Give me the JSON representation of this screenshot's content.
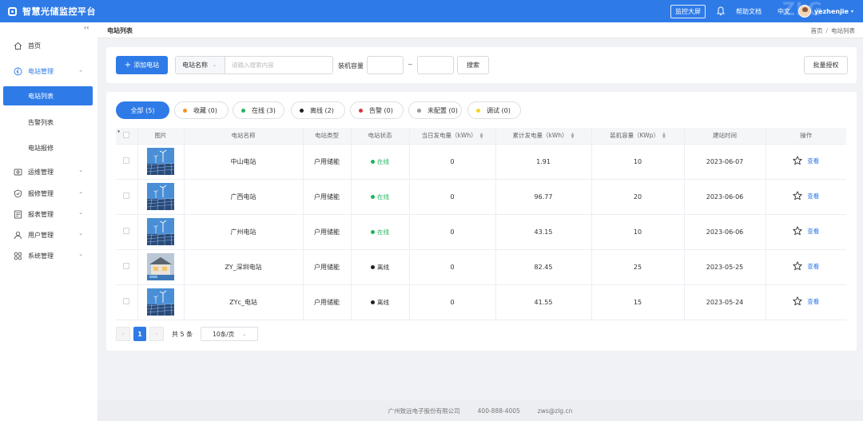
{
  "header": {
    "app_title": "智慧光储监控平台",
    "monitor_button": "监控大屏",
    "help": "帮助文档",
    "language": "中文",
    "watermark": "ZLG",
    "username": "yezhenjie",
    "user_caret": "▾",
    "colors": {
      "header_bg": "#2e7be8"
    }
  },
  "sidebar": {
    "collapse_glyph": "‹‹",
    "items": [
      {
        "label": "首页",
        "icon": "home-icon"
      },
      {
        "label": "电站管理",
        "icon": "plant-icon",
        "expanded": true
      },
      {
        "label": "运维管理",
        "icon": "maintenance-icon"
      },
      {
        "label": "报修管理",
        "icon": "repair-icon"
      },
      {
        "label": "报表管理",
        "icon": "report-icon"
      },
      {
        "label": "用户管理",
        "icon": "user-icon"
      },
      {
        "label": "系统管理",
        "icon": "system-icon"
      }
    ],
    "submenu": [
      {
        "label": "电站列表",
        "active": true
      },
      {
        "label": "告警列表"
      },
      {
        "label": "电站报修"
      }
    ],
    "arrow_down": "⌄",
    "arrow_up": "⌃"
  },
  "breadcrumb": {
    "page_title": "电站列表",
    "path": [
      "首页",
      "电站列表"
    ],
    "separator": "/"
  },
  "filter": {
    "add_button": "添加电站",
    "add_plus": "+",
    "search_field_select": "电站名称",
    "search_placeholder": "请输入搜索内容",
    "capacity_label": "装机容量",
    "range_separator": "~",
    "search_button": "搜索",
    "batch_button": "批量授权"
  },
  "status_tabs": [
    {
      "label": "全部 (5)",
      "active": true
    },
    {
      "label": "收藏 (0)",
      "dot_color": "#f7941d"
    },
    {
      "label": "在线 (3)",
      "dot_color": "#22b35e"
    },
    {
      "label": "离线 (2)",
      "dot_color": "#222222"
    },
    {
      "label": "告警 (0)",
      "dot_color": "#d9363e"
    },
    {
      "label": "未配置 (0)",
      "dot_color": "#999999"
    },
    {
      "label": "调试 (0)",
      "dot_color": "#f5d524"
    }
  ],
  "table": {
    "columns": [
      "图片",
      "电站名称",
      "电站类型",
      "电站状态",
      "当日发电量（kWh）",
      "累计发电量（kWh）",
      "装机容量（KWp）",
      "建站时间",
      "操作"
    ],
    "rows": [
      {
        "image": "solar-wind-photo",
        "name": "中山电站",
        "type": "户用储能",
        "status": "在线",
        "status_kind": "online",
        "daily": "0",
        "total": "1.91",
        "capacity": "10",
        "date": "2023-06-07",
        "action": "查看"
      },
      {
        "image": "solar-wind-photo",
        "name": "广西电站",
        "type": "户用储能",
        "status": "在线",
        "status_kind": "online",
        "daily": "0",
        "total": "96.77",
        "capacity": "20",
        "date": "2023-06-06",
        "action": "查看"
      },
      {
        "image": "solar-wind-photo",
        "name": "广州电站",
        "type": "户用储能",
        "status": "在线",
        "status_kind": "online",
        "daily": "0",
        "total": "43.15",
        "capacity": "10",
        "date": "2023-06-06",
        "action": "查看"
      },
      {
        "image": "house-photo",
        "name": "ZY_深圳电站",
        "type": "户用储能",
        "status": "离线",
        "status_kind": "offline",
        "daily": "0",
        "total": "82.45",
        "capacity": "25",
        "date": "2023-05-25",
        "action": "查看"
      },
      {
        "image": "solar-wind-photo",
        "name": "ZYc_电站",
        "type": "户用储能",
        "status": "离线",
        "status_kind": "offline",
        "daily": "0",
        "total": "41.55",
        "capacity": "15",
        "date": "2023-05-24",
        "action": "查看"
      }
    ],
    "status_colors": {
      "online": "#22b35e",
      "offline": "#222222"
    }
  },
  "pagination": {
    "prev": "‹",
    "next": "›",
    "current_page": "1",
    "total": "共 5 条",
    "page_size": "10条/页"
  },
  "footer": {
    "company": "广州致远电子股份有限公司",
    "phone": "400-888-4005",
    "email": "zws@zlg.cn"
  }
}
